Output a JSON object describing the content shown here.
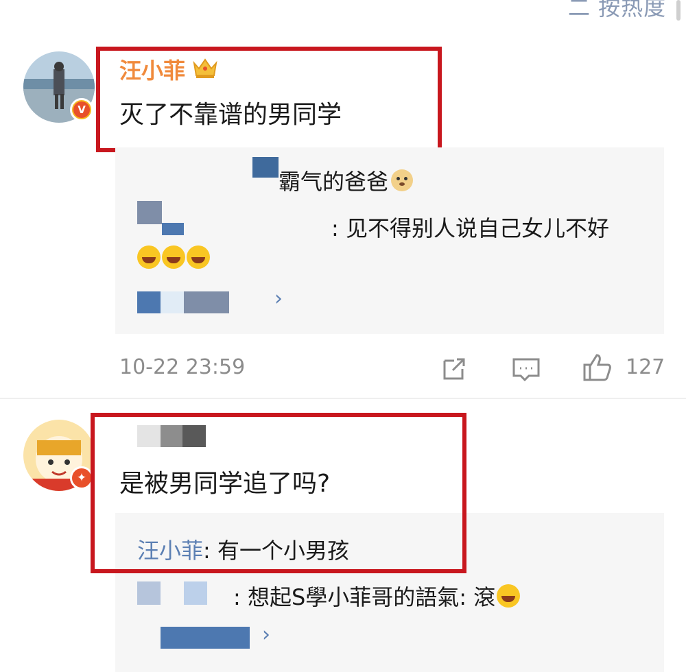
{
  "header": {
    "sort_label": "二 按热度"
  },
  "comments": [
    {
      "user": "汪小菲",
      "text": "灭了不靠谱的男同学",
      "replies": [
        {
          "name_tail": "霸气的爸爸",
          "text": ""
        },
        {
          "text": ": 见不得别人说自己女儿不好"
        }
      ],
      "date": "10-22 23:59",
      "likes": "127"
    },
    {
      "user": "",
      "text": "是被男同学追了吗?",
      "replies": [
        {
          "name": "汪小菲",
          "text": ": 有一个小男孩"
        },
        {
          "text": ": 想起S學小菲哥的語氣: 滾"
        }
      ]
    }
  ],
  "icons": {
    "crown": "crown-badge-icon",
    "verified": "verified-v-icon",
    "star_badge": "star-badge-icon",
    "share": "share-icon",
    "comment": "comment-icon",
    "like": "thumbs-up-icon",
    "more": "chevron-right-icon"
  },
  "colors": {
    "highlight_frame": "#c8171e",
    "vip_name": "#f08a3c",
    "link_name": "#5b7fb3"
  }
}
